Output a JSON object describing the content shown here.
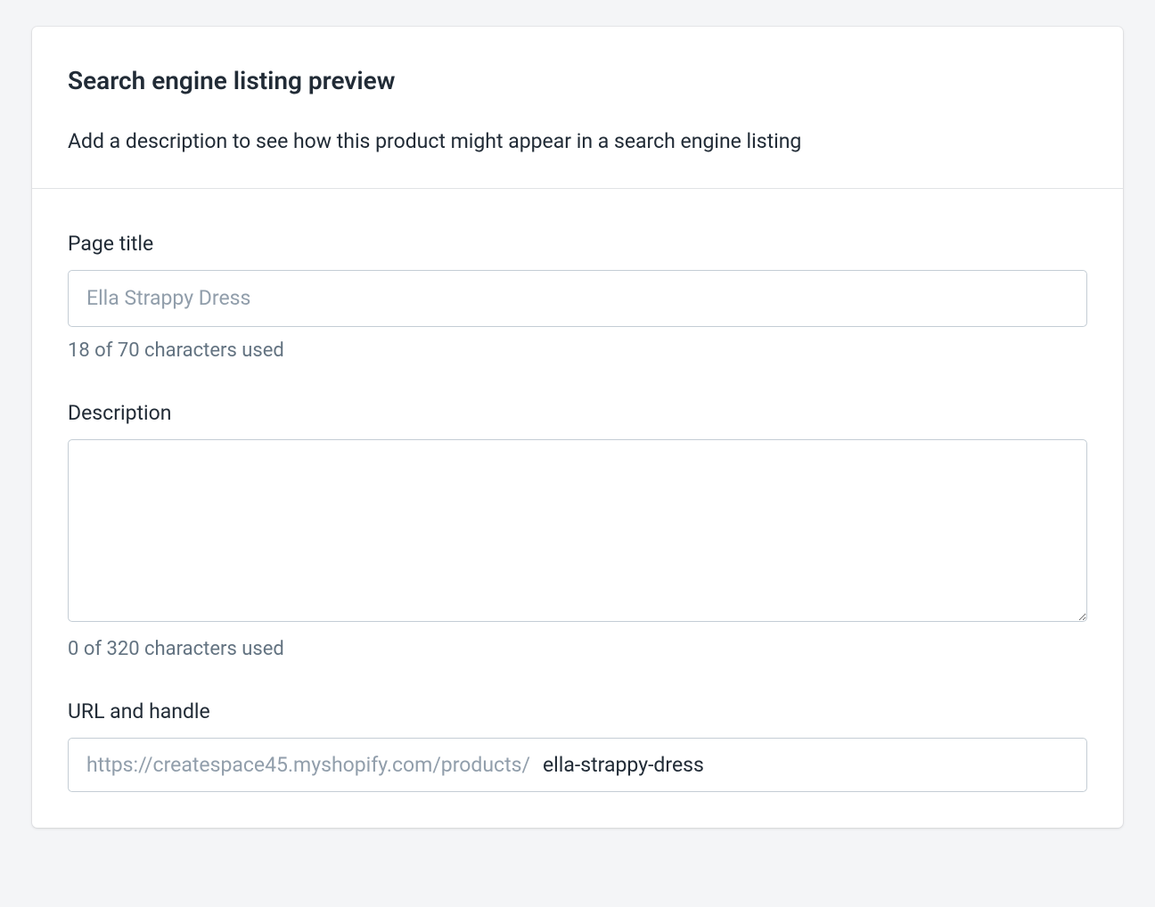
{
  "card": {
    "title": "Search engine listing preview",
    "subtitle": "Add a description to see how this product might appear in a search engine listing"
  },
  "page_title": {
    "label": "Page title",
    "placeholder": "Ella Strappy Dress",
    "value": "",
    "helper": "18 of 70 characters used"
  },
  "description": {
    "label": "Description",
    "value": "",
    "helper": "0 of 320 characters used"
  },
  "url_handle": {
    "label": "URL and handle",
    "prefix": "https://createspace45.myshopify.com/products/",
    "value": "ella-strappy-dress"
  }
}
